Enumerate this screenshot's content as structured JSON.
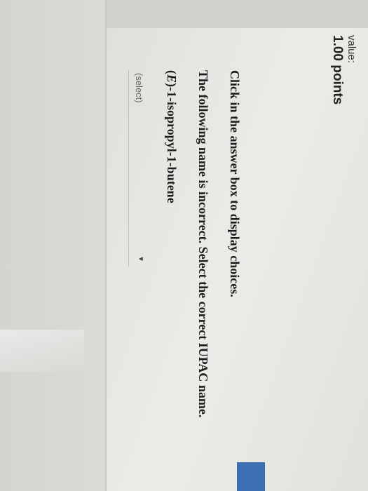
{
  "header": {
    "value_label": "value:",
    "points": "1.00 points"
  },
  "question": {
    "instruction": "Click in the answer box to display choices.",
    "prompt": "The following name is incorrect. Select the correct IUPAC name.",
    "name_text": "(E)-1-isopropyl-1-butene"
  },
  "answer": {
    "select_placeholder": "(select)",
    "arrow_icon": "dropdown-arrow-icon"
  },
  "colors": {
    "accent_tab": "#3d6fb5"
  }
}
